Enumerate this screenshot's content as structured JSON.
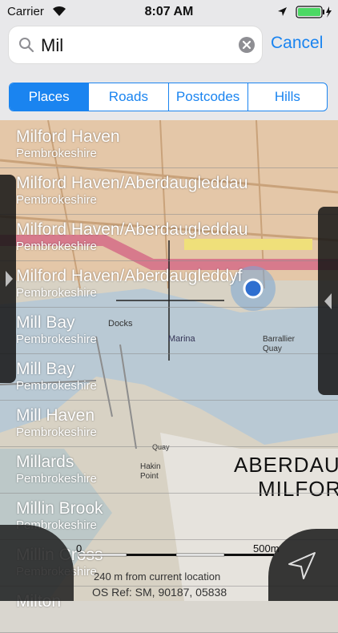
{
  "status_bar": {
    "carrier": "Carrier",
    "time": "8:07 AM"
  },
  "search": {
    "value": "Mil",
    "cancel_label": "Cancel"
  },
  "segments": [
    "Places",
    "Roads",
    "Postcodes",
    "Hills"
  ],
  "results": [
    {
      "name": "Milford Haven",
      "county": "Pembrokeshire"
    },
    {
      "name": "Milford Haven/Aberdaugleddau",
      "county": "Pembrokeshire"
    },
    {
      "name": "Milford Haven/Aberdaugleddau",
      "county": "Pembrokeshire"
    },
    {
      "name": "Milford Haven/Aberdaugleddyf",
      "county": "Pembrokeshire"
    },
    {
      "name": "Mill Bay",
      "county": "Pembrokeshire"
    },
    {
      "name": "Mill Bay",
      "county": "Pembrokeshire"
    },
    {
      "name": "Mill Haven",
      "county": "Pembrokeshire"
    },
    {
      "name": "Millards",
      "county": "Pembrokeshire"
    },
    {
      "name": "Millin Brook",
      "county": "Pembrokeshire"
    },
    {
      "name": "Millin Cross",
      "county": "Pembrokeshire"
    },
    {
      "name": "Milton",
      "county": ""
    }
  ],
  "map": {
    "labels": [
      "ABERDAU",
      "MILFOR",
      "Docks",
      "Marina",
      "Barrallier Quay",
      "Hakin Point",
      "Quay"
    ],
    "scale_start": "0",
    "scale_end": "500m",
    "distance": "240 m from current location",
    "os_ref": "OS Ref: SM, 90187, 05838"
  },
  "colors": {
    "accent": "#1a84f0",
    "battery": "#4cd964"
  }
}
